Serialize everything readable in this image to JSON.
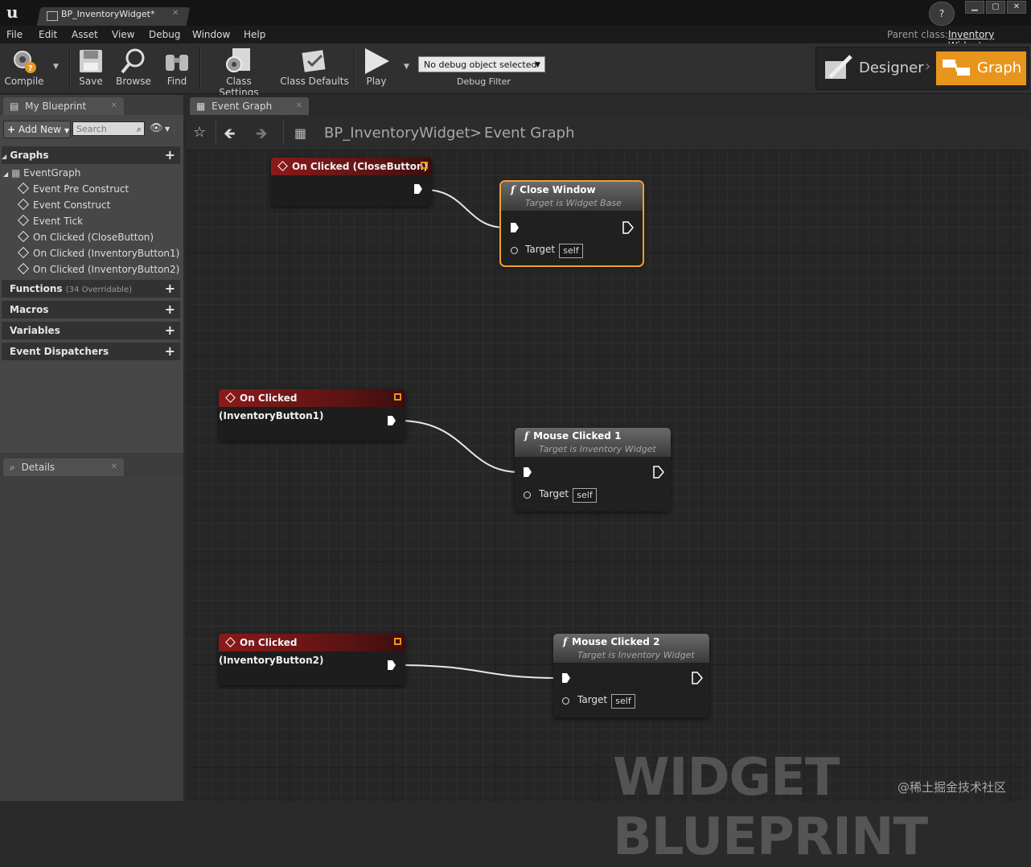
{
  "window": {
    "tab_title": "BP_InventoryWidget*",
    "parent_class_label": "Parent class:",
    "parent_class_value": "Inventory Widget"
  },
  "menu": [
    "File",
    "Edit",
    "Asset",
    "View",
    "Debug",
    "Window",
    "Help"
  ],
  "toolbar": {
    "compile": "Compile",
    "save": "Save",
    "browse": "Browse",
    "find": "Find",
    "class_settings": "Class Settings",
    "class_defaults": "Class Defaults",
    "play": "Play",
    "debug_select": "No debug object selected",
    "debug_filter": "Debug Filter",
    "designer": "Designer",
    "graph": "Graph"
  },
  "left_panel": {
    "tab": "My Blueprint",
    "add_new": "Add New",
    "search_placeholder": "Search",
    "graphs_header": "Graphs",
    "event_graph": "EventGraph",
    "events": [
      "Event Pre Construct",
      "Event Construct",
      "Event Tick",
      "On Clicked (CloseButton)",
      "On Clicked (InventoryButton1)",
      "On Clicked (InventoryButton2)"
    ],
    "functions_header": "Functions",
    "functions_count": "(34 Overridable)",
    "macros_header": "Macros",
    "variables_header": "Variables",
    "dispatchers_header": "Event Dispatchers",
    "details_tab": "Details"
  },
  "graph": {
    "tab": "Event Graph",
    "breadcrumb_asset": "BP_InventoryWidget",
    "breadcrumb_sep": ">",
    "breadcrumb_graph": "Event Graph",
    "watermark": "WIDGET BLUEPRINT",
    "credit": "@稀土掘金技术社区",
    "nodes": {
      "event1": "On Clicked (CloseButton)",
      "event2": "On Clicked (InventoryButton1)",
      "event3": "On Clicked (InventoryButton2)",
      "func1_title": "Close Window",
      "func1_sub": "Target is Widget Base",
      "func2_title": "Mouse Clicked 1",
      "func2_sub": "Target is Inventory Widget",
      "func3_title": "Mouse Clicked 2",
      "func3_sub": "Target is Inventory Widget",
      "target_label": "Target",
      "self_value": "self"
    }
  }
}
